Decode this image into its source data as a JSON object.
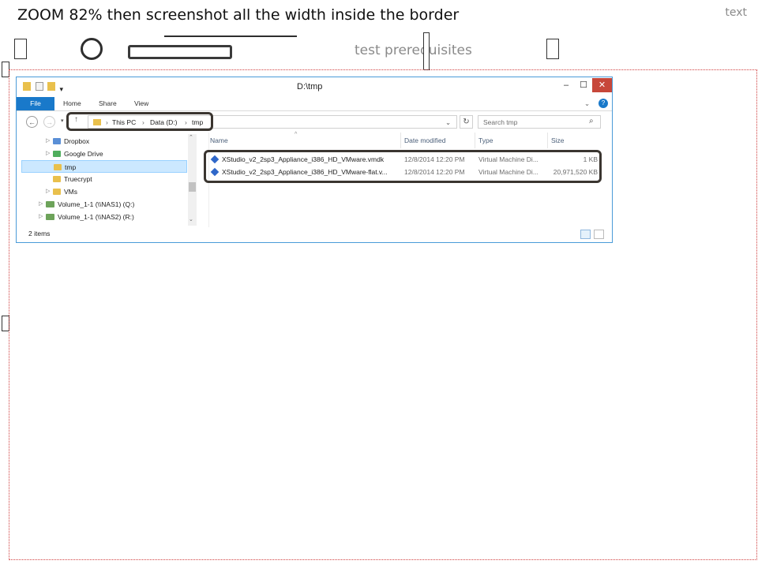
{
  "slide": {
    "title": "ZOOM 82% then screenshot all the width inside the border",
    "corner_text": "text",
    "subtitle": "test prerequisites"
  },
  "explorer": {
    "window_title": "D:\\tmp",
    "ribbon_tabs": [
      "File",
      "Home",
      "Share",
      "View"
    ],
    "breadcrumb": [
      "This PC",
      "Data (D:)",
      "tmp"
    ],
    "search_placeholder": "Search tmp",
    "nav_items": [
      {
        "label": "Dropbox",
        "icon": "dropbox-icon"
      },
      {
        "label": "Google Drive",
        "icon": "google-drive-icon"
      },
      {
        "label": "tmp",
        "icon": "folder-icon",
        "selected": true
      },
      {
        "label": "Truecrypt",
        "icon": "folder-icon"
      },
      {
        "label": "VMs",
        "icon": "folder-icon"
      },
      {
        "label": "Volume_1-1 (\\\\NAS1) (Q:)",
        "icon": "network-drive-icon"
      },
      {
        "label": "Volume_1-1 (\\\\NAS2) (R:)",
        "icon": "network-drive-icon"
      }
    ],
    "columns": [
      "Name",
      "Date modified",
      "Type",
      "Size"
    ],
    "files": [
      {
        "name": "XStudio_v2_2sp3_Appliance_i386_HD_VMware.vmdk",
        "date": "12/8/2014 12:20 PM",
        "type": "Virtual Machine Di...",
        "size": "1 KB"
      },
      {
        "name": "XStudio_v2_2sp3_Appliance_i386_HD_VMware-flat.v...",
        "date": "12/8/2014 12:20 PM",
        "type": "Virtual Machine Di...",
        "size": "20,971,520 KB"
      }
    ],
    "status": "2 items"
  }
}
